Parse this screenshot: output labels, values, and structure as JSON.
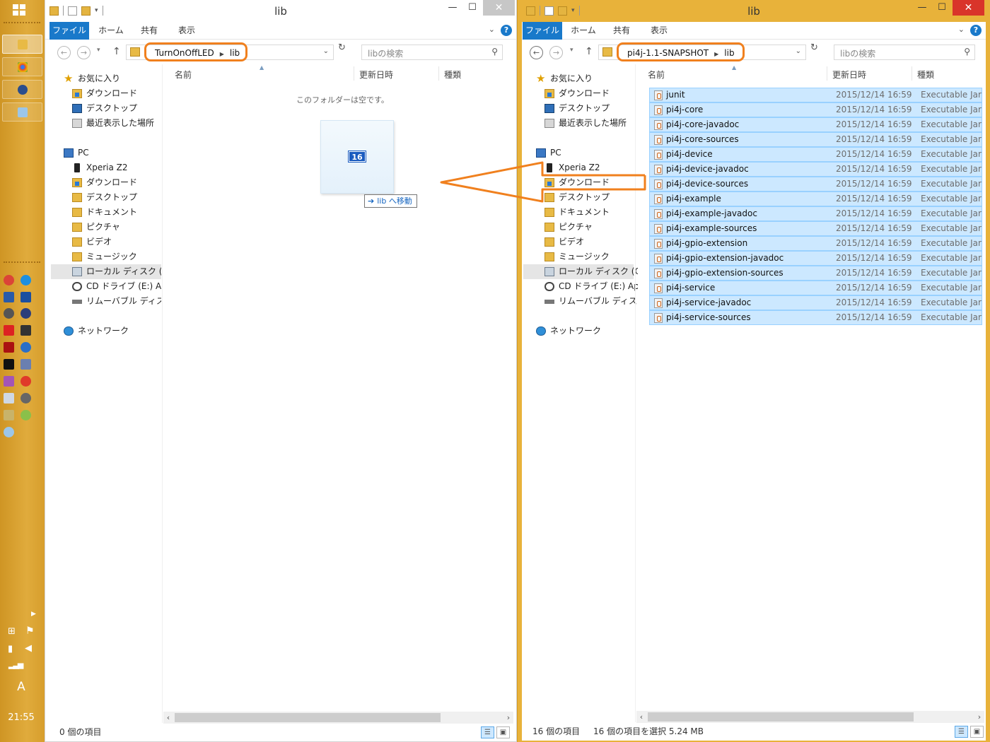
{
  "desktop": {
    "clock": "21:55",
    "ime_indicator": "A"
  },
  "left_window": {
    "title": "lib",
    "ribbon_tabs": [
      "ファイル",
      "ホーム",
      "共有",
      "表示"
    ],
    "breadcrumb": [
      "TurnOnOffLED",
      "lib"
    ],
    "search_placeholder": "libの検索",
    "columns": [
      "名前",
      "更新日時",
      "種類"
    ],
    "empty_message": "このフォルダーは空です。",
    "drag_count": "16",
    "drag_tooltip": "lib へ移動",
    "status_items": "0 個の項目"
  },
  "right_window": {
    "title": "lib",
    "ribbon_tabs": [
      "ファイル",
      "ホーム",
      "共有",
      "表示"
    ],
    "breadcrumb": [
      "pi4j-1.1-SNAPSHOT",
      "lib"
    ],
    "search_placeholder": "libの検索",
    "columns": [
      "名前",
      "更新日時",
      "種類"
    ],
    "files": [
      {
        "name": "junit",
        "date": "2015/12/14 16:59",
        "type": "Executable Jar ..."
      },
      {
        "name": "pi4j-core",
        "date": "2015/12/14 16:59",
        "type": "Executable Jar ..."
      },
      {
        "name": "pi4j-core-javadoc",
        "date": "2015/12/14 16:59",
        "type": "Executable Jar ..."
      },
      {
        "name": "pi4j-core-sources",
        "date": "2015/12/14 16:59",
        "type": "Executable Jar ..."
      },
      {
        "name": "pi4j-device",
        "date": "2015/12/14 16:59",
        "type": "Executable Jar ..."
      },
      {
        "name": "pi4j-device-javadoc",
        "date": "2015/12/14 16:59",
        "type": "Executable Jar ..."
      },
      {
        "name": "pi4j-device-sources",
        "date": "2015/12/14 16:59",
        "type": "Executable Jar ..."
      },
      {
        "name": "pi4j-example",
        "date": "2015/12/14 16:59",
        "type": "Executable Jar ..."
      },
      {
        "name": "pi4j-example-javadoc",
        "date": "2015/12/14 16:59",
        "type": "Executable Jar ..."
      },
      {
        "name": "pi4j-example-sources",
        "date": "2015/12/14 16:59",
        "type": "Executable Jar ..."
      },
      {
        "name": "pi4j-gpio-extension",
        "date": "2015/12/14 16:59",
        "type": "Executable Jar ..."
      },
      {
        "name": "pi4j-gpio-extension-javadoc",
        "date": "2015/12/14 16:59",
        "type": "Executable Jar ..."
      },
      {
        "name": "pi4j-gpio-extension-sources",
        "date": "2015/12/14 16:59",
        "type": "Executable Jar ..."
      },
      {
        "name": "pi4j-service",
        "date": "2015/12/14 16:59",
        "type": "Executable Jar ..."
      },
      {
        "name": "pi4j-service-javadoc",
        "date": "2015/12/14 16:59",
        "type": "Executable Jar ..."
      },
      {
        "name": "pi4j-service-sources",
        "date": "2015/12/14 16:59",
        "type": "Executable Jar ..."
      }
    ],
    "status_items": "16 個の項目",
    "status_selected": "16 個の項目を選択  5.24 MB"
  },
  "nav_pane": {
    "favorites": "お気に入り",
    "downloads": "ダウンロード",
    "desktop": "デスクトップ",
    "recent": "最近表示した場所",
    "pc": "PC",
    "xperia": "Xperia Z2",
    "pc_downloads": "ダウンロード",
    "pc_desktop": "デスクトップ",
    "documents": "ドキュメント",
    "pictures": "ピクチャ",
    "videos": "ビデオ",
    "music": "ミュージック",
    "local_disk": "ローカル ディスク (C:)",
    "cd_drive": "CD ドライブ (E:) App",
    "removable": "リムーバブル ディスク (F",
    "network": "ネットワーク"
  },
  "colors": {
    "accent_blue": "#1979ca",
    "annotation_orange": "#f0801e",
    "active_frame": "#e8b23a",
    "selection": "#cce8ff"
  }
}
